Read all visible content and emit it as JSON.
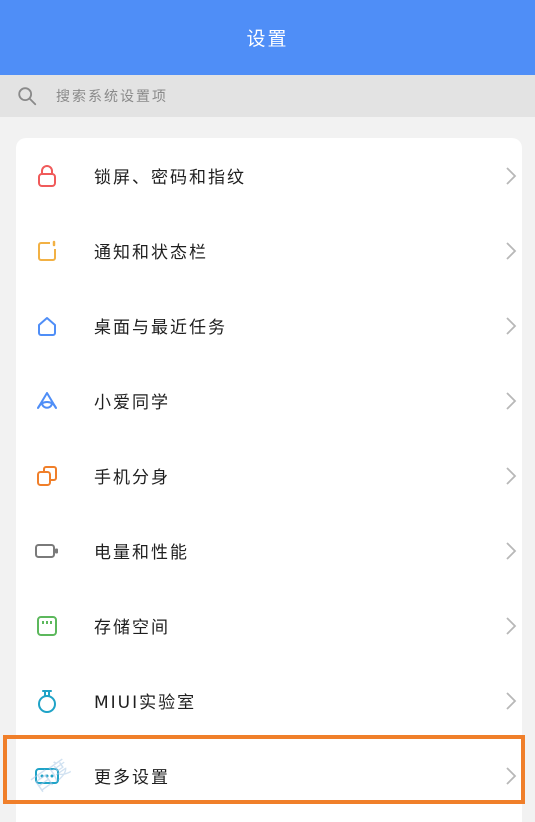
{
  "header": {
    "title": "设置"
  },
  "search": {
    "placeholder": "搜索系统设置项"
  },
  "items": [
    {
      "label": "锁屏、密码和指纹",
      "icon": "lock-icon",
      "color": "#f05a5a"
    },
    {
      "label": "通知和状态栏",
      "icon": "notification-icon",
      "color": "#f2b144"
    },
    {
      "label": "桌面与最近任务",
      "icon": "home-icon",
      "color": "#4f8ef7"
    },
    {
      "label": "小爱同学",
      "icon": "xiaoai-icon",
      "color": "#4f8ef7"
    },
    {
      "label": "手机分身",
      "icon": "dual-space-icon",
      "color": "#f07f2a"
    },
    {
      "label": "电量和性能",
      "icon": "battery-icon",
      "color": "#7a7a7a"
    },
    {
      "label": "存储空间",
      "icon": "storage-icon",
      "color": "#5cb85c"
    },
    {
      "label": "MIUI实验室",
      "icon": "lab-flask-icon",
      "color": "#1fa3c7"
    },
    {
      "label": "更多设置",
      "icon": "more-settings-icon",
      "color": "#1fa3c7"
    }
  ],
  "watermark": "百度"
}
